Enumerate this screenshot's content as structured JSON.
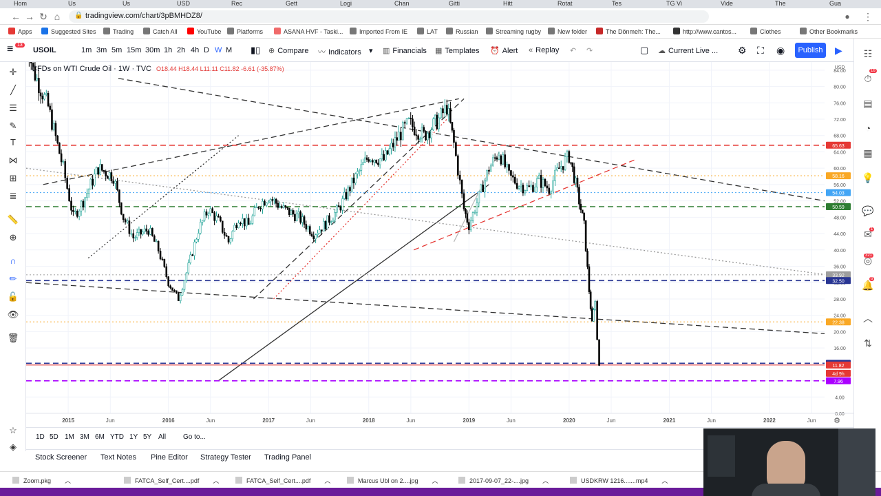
{
  "browser": {
    "tabs": [
      "Hom",
      "Us",
      "Us",
      "USD",
      "Rec",
      "Gett",
      "Logi",
      "Chan",
      "Gitti",
      "Hitt",
      "Rotat",
      "Tes",
      "TG Vi",
      "Vide",
      "The",
      "Gua"
    ],
    "url": "tradingview.com/chart/3pBMHDZ8/"
  },
  "bookmarks": [
    {
      "label": "Apps",
      "color": "#e53935"
    },
    {
      "label": "Suggested Sites",
      "color": "#1a73e8"
    },
    {
      "label": "Trading",
      "color": "#777"
    },
    {
      "label": "Catch All",
      "color": "#777"
    },
    {
      "label": "YouTube",
      "color": "#ff0000"
    },
    {
      "label": "Platforms",
      "color": "#777"
    },
    {
      "label": "ASANA HVF - Taski...",
      "color": "#f06a6a"
    },
    {
      "label": "Imported From IE",
      "color": "#777"
    },
    {
      "label": "LAT",
      "color": "#777"
    },
    {
      "label": "Russian",
      "color": "#777"
    },
    {
      "label": "Streaming rugby",
      "color": "#777"
    },
    {
      "label": "New folder",
      "color": "#777"
    },
    {
      "label": "The Dönmeh: The...",
      "color": "#c62828"
    },
    {
      "label": "http://www.cantos...",
      "color": "#333"
    },
    {
      "label": "Clothes",
      "color": "#777"
    },
    {
      "label": "Other Bookmarks",
      "color": "#777"
    }
  ],
  "toolbar": {
    "symbol": "USOIL",
    "intervals": [
      "1m",
      "3m",
      "5m",
      "15m",
      "30m",
      "1h",
      "2h",
      "4h",
      "D",
      "W",
      "M"
    ],
    "active_interval": "W",
    "compare": "Compare",
    "indicators": "Indicators",
    "financials": "Financials",
    "templates": "Templates",
    "alert": "Alert",
    "replay": "Replay",
    "layout": "Current Live ...",
    "publish": "Publish",
    "notif_badge": "13"
  },
  "legend": {
    "title": "CFDs on WTI Crude Oil · 1W · TVC",
    "ohlc": "O18.44 H18.44 L11.11 C11.82 -6.61 (-35.87%)"
  },
  "chart_data": {
    "type": "candlestick",
    "title": "CFDs on WTI Crude Oil · 1W · TVC",
    "currency": "USD",
    "y_ticks": [
      0,
      4,
      8,
      12,
      16,
      20,
      24,
      28,
      32,
      36,
      40,
      44,
      48,
      52,
      56,
      60,
      64,
      68,
      72,
      76,
      80,
      84
    ],
    "ylim": [
      0,
      86
    ],
    "x_tick_labels": [
      "2015",
      "Jun",
      "2016",
      "Jun",
      "2017",
      "Jun",
      "2018",
      "Jun",
      "2019",
      "Jun",
      "2020",
      "Jun",
      "2021",
      "Jun",
      "2022",
      "Jun"
    ],
    "x_tick_values": [
      2015.0,
      2015.42,
      2016.0,
      2016.42,
      2017.0,
      2017.42,
      2018.0,
      2018.42,
      2019.0,
      2019.42,
      2020.0,
      2020.42,
      2021.0,
      2021.42,
      2022.0,
      2022.42
    ],
    "xlim": [
      2014.58,
      2022.55
    ],
    "price_path": [
      [
        2014.55,
        95
      ],
      [
        2014.65,
        84
      ],
      [
        2014.8,
        75
      ],
      [
        2014.95,
        60
      ],
      [
        2015.05,
        48
      ],
      [
        2015.15,
        52
      ],
      [
        2015.3,
        60
      ],
      [
        2015.45,
        58
      ],
      [
        2015.55,
        48
      ],
      [
        2015.65,
        43
      ],
      [
        2015.8,
        45
      ],
      [
        2015.9,
        40
      ],
      [
        2016.0,
        32
      ],
      [
        2016.1,
        28
      ],
      [
        2016.2,
        36
      ],
      [
        2016.3,
        45
      ],
      [
        2016.4,
        50
      ],
      [
        2016.5,
        47
      ],
      [
        2016.6,
        42
      ],
      [
        2016.7,
        48
      ],
      [
        2016.8,
        46
      ],
      [
        2016.9,
        51
      ],
      [
        2017.0,
        53
      ],
      [
        2017.15,
        50
      ],
      [
        2017.3,
        48
      ],
      [
        2017.45,
        44
      ],
      [
        2017.55,
        46
      ],
      [
        2017.7,
        50
      ],
      [
        2017.85,
        57
      ],
      [
        2018.0,
        63
      ],
      [
        2018.15,
        62
      ],
      [
        2018.3,
        68
      ],
      [
        2018.4,
        71
      ],
      [
        2018.55,
        68
      ],
      [
        2018.7,
        72
      ],
      [
        2018.78,
        75
      ],
      [
        2018.85,
        66
      ],
      [
        2018.95,
        50
      ],
      [
        2019.0,
        46
      ],
      [
        2019.1,
        53
      ],
      [
        2019.2,
        60
      ],
      [
        2019.3,
        64
      ],
      [
        2019.4,
        58
      ],
      [
        2019.5,
        56
      ],
      [
        2019.6,
        55
      ],
      [
        2019.7,
        57
      ],
      [
        2019.8,
        55
      ],
      [
        2019.9,
        60
      ],
      [
        2020.0,
        63
      ],
      [
        2020.05,
        58
      ],
      [
        2020.1,
        52
      ],
      [
        2020.15,
        46
      ],
      [
        2020.2,
        30
      ],
      [
        2020.23,
        22
      ],
      [
        2020.26,
        28
      ],
      [
        2020.28,
        18
      ],
      [
        2020.3,
        11.82
      ]
    ],
    "horizontal_levels": [
      {
        "price": 65.63,
        "label": "65.63",
        "color": "#e53935",
        "style": "dashed"
      },
      {
        "price": 58.16,
        "label": "58.16",
        "color": "#f9a825",
        "style": "dotted"
      },
      {
        "price": 54.03,
        "label": "54.03",
        "color": "#42a5f5",
        "style": "dotted"
      },
      {
        "price": 50.59,
        "label": "50.59",
        "color": "#2e7d32",
        "style": "dashed"
      },
      {
        "price": 33.92,
        "label": "33.92",
        "color": "#9e9e9e",
        "style": "dotted"
      },
      {
        "price": 32.5,
        "label": "32.50",
        "color": "#283593",
        "style": "dashed"
      },
      {
        "price": 22.38,
        "label": "22.38",
        "color": "#f9a825",
        "style": "dotted"
      },
      {
        "price": 12.25,
        "label": "12.25",
        "color": "#283593",
        "style": "dashed"
      },
      {
        "price": 11.82,
        "label": "11.82",
        "color": "#e53935",
        "style": "solid"
      },
      {
        "price": 7.96,
        "label": "7.96",
        "color": "#aa00ff",
        "style": "dashed"
      }
    ],
    "countdown_label": "4d 9h",
    "trend_lines": [
      {
        "from": [
          2014.75,
          56
        ],
        "to": [
          2018.9,
          77
        ],
        "color": "#333",
        "style": "dashed"
      },
      {
        "from": [
          2016.85,
          28
        ],
        "to": [
          2018.95,
          77
        ],
        "color": "#333",
        "style": "dashed"
      },
      {
        "from": [
          2017.05,
          28
        ],
        "to": [
          2018.78,
          72
        ],
        "color": "#e53935",
        "style": "dotted"
      },
      {
        "from": [
          2014.58,
          32
        ],
        "to": [
          2022.55,
          19.5
        ],
        "color": "#333",
        "style": "dashed"
      },
      {
        "from": [
          2015.5,
          82
        ],
        "to": [
          2022.55,
          52
        ],
        "color": "#333",
        "style": "dashed"
      },
      {
        "from": [
          2016.5,
          8
        ],
        "to": [
          2019.2,
          56
        ],
        "color": "#333",
        "style": "solid"
      },
      {
        "from": [
          2018.85,
          42
        ],
        "to": [
          2019.3,
          64
        ],
        "color": "#bbb",
        "style": "solid"
      },
      {
        "from": [
          2015.2,
          38
        ],
        "to": [
          2016.7,
          68
        ],
        "color": "#333",
        "style": "dotted"
      },
      {
        "from": [
          2018.45,
          40
        ],
        "to": [
          2020.65,
          62
        ],
        "color": "#e53935",
        "style": "dashed"
      },
      {
        "from": [
          2014.58,
          60
        ],
        "to": [
          2022.55,
          34
        ],
        "color": "#999",
        "style": "dotted"
      }
    ]
  },
  "range_bar": [
    "1D",
    "5D",
    "1M",
    "3M",
    "6M",
    "YTD",
    "1Y",
    "5Y",
    "All"
  ],
  "goto": "Go to...",
  "bottom_tabs": [
    "Stock Screener",
    "Text Notes",
    "Pine Editor",
    "Strategy Tester",
    "Trading Panel"
  ],
  "downloads": [
    "Zoom.pkg",
    "FATCA_Self_Cert....pdf",
    "FATCA_Self_Cert....pdf",
    "Marcus Ubl on 2....jpg",
    "2017-09-07_22-....jpg",
    "USDKRW 1216.......mp4"
  ],
  "right_badges": [
    "16",
    "1",
    "321",
    "6"
  ]
}
